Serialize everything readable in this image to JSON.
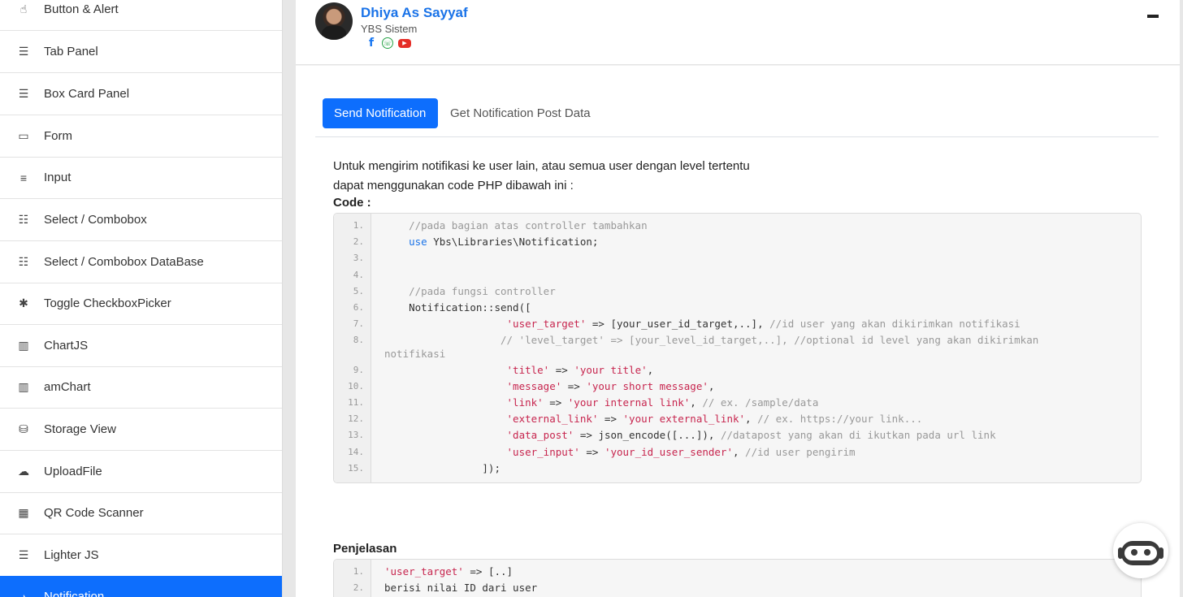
{
  "sidebar": {
    "items": [
      {
        "label": "Button & Alert",
        "icon": "pointer-icon"
      },
      {
        "label": "Tab Panel",
        "icon": "list-alt-icon"
      },
      {
        "label": "Box Card Panel",
        "icon": "list-alt-icon"
      },
      {
        "label": "Form",
        "icon": "window-icon"
      },
      {
        "label": "Input",
        "icon": "align-center-icon"
      },
      {
        "label": "Select / Combobox",
        "icon": "list-icon"
      },
      {
        "label": "Select / Combobox DataBase",
        "icon": "list-icon"
      },
      {
        "label": "Toggle CheckboxPicker",
        "icon": "puzzle-icon"
      },
      {
        "label": "ChartJS",
        "icon": "bar-chart-icon"
      },
      {
        "label": "amChart",
        "icon": "bar-chart-icon"
      },
      {
        "label": "Storage View",
        "icon": "database-icon"
      },
      {
        "label": "UploadFile",
        "icon": "cloud-upload-icon"
      },
      {
        "label": "QR Code Scanner",
        "icon": "qrcode-icon"
      },
      {
        "label": "Lighter JS",
        "icon": "list-alt-icon"
      },
      {
        "label": "Notification",
        "icon": "bell-icon"
      }
    ],
    "accent": "#0d6efd"
  },
  "profile": {
    "name": "Dhiya As Sayyaf",
    "org": "YBS Sistem",
    "socials": [
      "facebook-icon",
      "whatsapp-icon",
      "youtube-icon"
    ]
  },
  "tabs": [
    {
      "label": "Send Notification",
      "active": true
    },
    {
      "label": "Get Notification Post Data",
      "active": false
    }
  ],
  "intro": {
    "line1": "Untuk mengirim notifikasi ke user lain, atau semua user dengan level tertentu",
    "line2": "dapat menggunakan code PHP dibawah ini :"
  },
  "code_label": "Code :",
  "code_lines": [
    {
      "n": "1.",
      "segs": [
        {
          "t": "    "
        },
        {
          "t": "//pada bagian atas controller tambahkan",
          "c": "cm"
        }
      ]
    },
    {
      "n": "2.",
      "segs": [
        {
          "t": "    "
        },
        {
          "t": "use",
          "c": "kw"
        },
        {
          "t": " Ybs\\Libraries\\Notification;"
        }
      ]
    },
    {
      "n": "3.",
      "segs": [
        {
          "t": ""
        }
      ]
    },
    {
      "n": "4.",
      "segs": [
        {
          "t": ""
        }
      ]
    },
    {
      "n": "5.",
      "segs": [
        {
          "t": "    "
        },
        {
          "t": "//pada fungsi controller",
          "c": "cm"
        }
      ]
    },
    {
      "n": "6.",
      "segs": [
        {
          "t": "    Notification::send(["
        }
      ]
    },
    {
      "n": "7.",
      "segs": [
        {
          "t": "                    "
        },
        {
          "t": "'user_target'",
          "c": "st"
        },
        {
          "t": " => [your_user_id_target,..], "
        },
        {
          "t": "//id user yang akan dikirimkan notifikasi",
          "c": "cm"
        }
      ]
    },
    {
      "n": "8.",
      "segs": [
        {
          "t": "                   "
        },
        {
          "t": "// 'level_target' => [your_level_id_target,..], //optional id level yang akan dikirimkan",
          "c": "cm"
        }
      ],
      "wrap": "notifikasi"
    },
    {
      "n": "9.",
      "segs": [
        {
          "t": "                    "
        },
        {
          "t": "'title'",
          "c": "st"
        },
        {
          "t": " => "
        },
        {
          "t": "'your title'",
          "c": "st"
        },
        {
          "t": ","
        }
      ]
    },
    {
      "n": "10.",
      "segs": [
        {
          "t": "                    "
        },
        {
          "t": "'message'",
          "c": "st"
        },
        {
          "t": " => "
        },
        {
          "t": "'your short message'",
          "c": "st"
        },
        {
          "t": ","
        }
      ]
    },
    {
      "n": "11.",
      "segs": [
        {
          "t": "                    "
        },
        {
          "t": "'link'",
          "c": "st"
        },
        {
          "t": " => "
        },
        {
          "t": "'your internal link'",
          "c": "st"
        },
        {
          "t": ", "
        },
        {
          "t": "// ex. /sample/data",
          "c": "cm"
        }
      ]
    },
    {
      "n": "12.",
      "segs": [
        {
          "t": "                    "
        },
        {
          "t": "'external_link'",
          "c": "st"
        },
        {
          "t": " => "
        },
        {
          "t": "'your external_link'",
          "c": "st"
        },
        {
          "t": ", "
        },
        {
          "t": "// ex. https://your link...",
          "c": "cm"
        }
      ]
    },
    {
      "n": "13.",
      "segs": [
        {
          "t": "                    "
        },
        {
          "t": "'data_post'",
          "c": "st"
        },
        {
          "t": " => json_encode([...]), "
        },
        {
          "t": "//datapost yang akan di ikutkan pada url link",
          "c": "cm"
        }
      ]
    },
    {
      "n": "14.",
      "segs": [
        {
          "t": "                    "
        },
        {
          "t": "'user_input'",
          "c": "st"
        },
        {
          "t": " => "
        },
        {
          "t": "'your_id_user_sender'",
          "c": "st"
        },
        {
          "t": ", "
        },
        {
          "t": "//id user pengirim",
          "c": "cm"
        }
      ]
    },
    {
      "n": "15.",
      "segs": [
        {
          "t": "                ]);"
        }
      ]
    }
  ],
  "explain_label": "Penjelasan",
  "explain_lines": [
    {
      "n": "1.",
      "segs": [
        {
          "t": "'user_target'",
          "c": "st"
        },
        {
          "t": " => [..]"
        }
      ]
    },
    {
      "n": "2.",
      "segs": [
        {
          "t": "berisi nilai ID dari user"
        }
      ]
    }
  ],
  "chatbot": {
    "icon": "chatbot-icon"
  }
}
